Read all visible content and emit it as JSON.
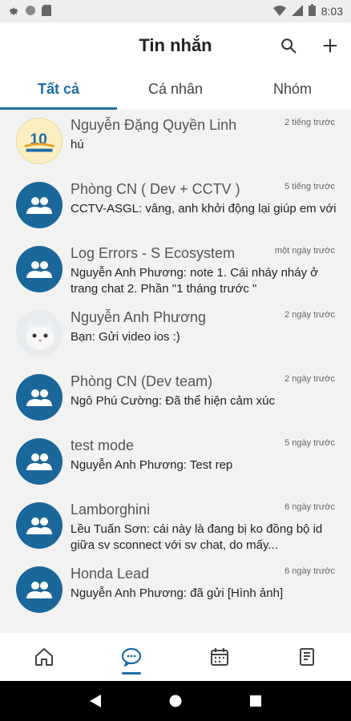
{
  "status_bar": {
    "time": "8:03"
  },
  "header": {
    "title": "Tin nhắn"
  },
  "tabs": [
    {
      "label": "Tất cả",
      "active": true
    },
    {
      "label": "Cá nhân",
      "active": false
    },
    {
      "label": "Nhóm",
      "active": false
    }
  ],
  "chats": [
    {
      "name": "Nguyễn Đặng Quyền Linh",
      "time": "2 tiếng trước",
      "sender": "",
      "message": "hú",
      "avatar": "anniversary-logo"
    },
    {
      "name": "Phòng CN ( Dev + CCTV )",
      "time": "5 tiếng trước",
      "sender": "CCTV-ASGL:",
      "message": "vâng, anh khởi động lại giúp em với",
      "avatar": "group-icon"
    },
    {
      "name": "Log Errors - S Ecosystem",
      "time": "một ngày trước",
      "sender": "Nguyễn Anh Phương:",
      "message": "note 1. Cái nháy nháy ở trang chat 2. Phần \"1 tháng trước \"",
      "avatar": "group-icon"
    },
    {
      "name": "Nguyễn Anh Phương",
      "time": "2 ngày trước",
      "sender": "",
      "message": "Bạn: Gửi video ios :)",
      "avatar": "cat-photo"
    },
    {
      "name": "Phòng CN (Dev team)",
      "time": "2 ngày trước",
      "sender": "Ngô Phú Cường:",
      "message": "Đã thể hiện cảm xúc",
      "avatar": "group-icon"
    },
    {
      "name": "test mode",
      "time": "5 ngày trước",
      "sender": "Nguyễn Anh Phương:",
      "message": "Test rep",
      "avatar": "group-icon"
    },
    {
      "name": "Lamborghini",
      "time": "6 ngày trước",
      "sender": "Lều Tuấn Sơn:",
      "message": "cái này là đang bị ko đồng bộ id giữa sv sconnect với sv chat, do mấy...",
      "avatar": "group-icon"
    },
    {
      "name": "Honda Lead",
      "time": "6 ngày trước",
      "sender": "Nguyễn Anh Phương:",
      "message": "đã gửi [Hình ảnh]",
      "avatar": "group-icon"
    }
  ],
  "bottom_nav": [
    {
      "icon": "home-icon",
      "active": false
    },
    {
      "icon": "chat-icon",
      "active": true
    },
    {
      "icon": "calendar-icon",
      "active": false
    },
    {
      "icon": "document-icon",
      "active": false
    }
  ],
  "colors": {
    "accent": "#1e6fa6",
    "group_avatar": "#1a679a",
    "list_bg": "#f2f2f2"
  }
}
